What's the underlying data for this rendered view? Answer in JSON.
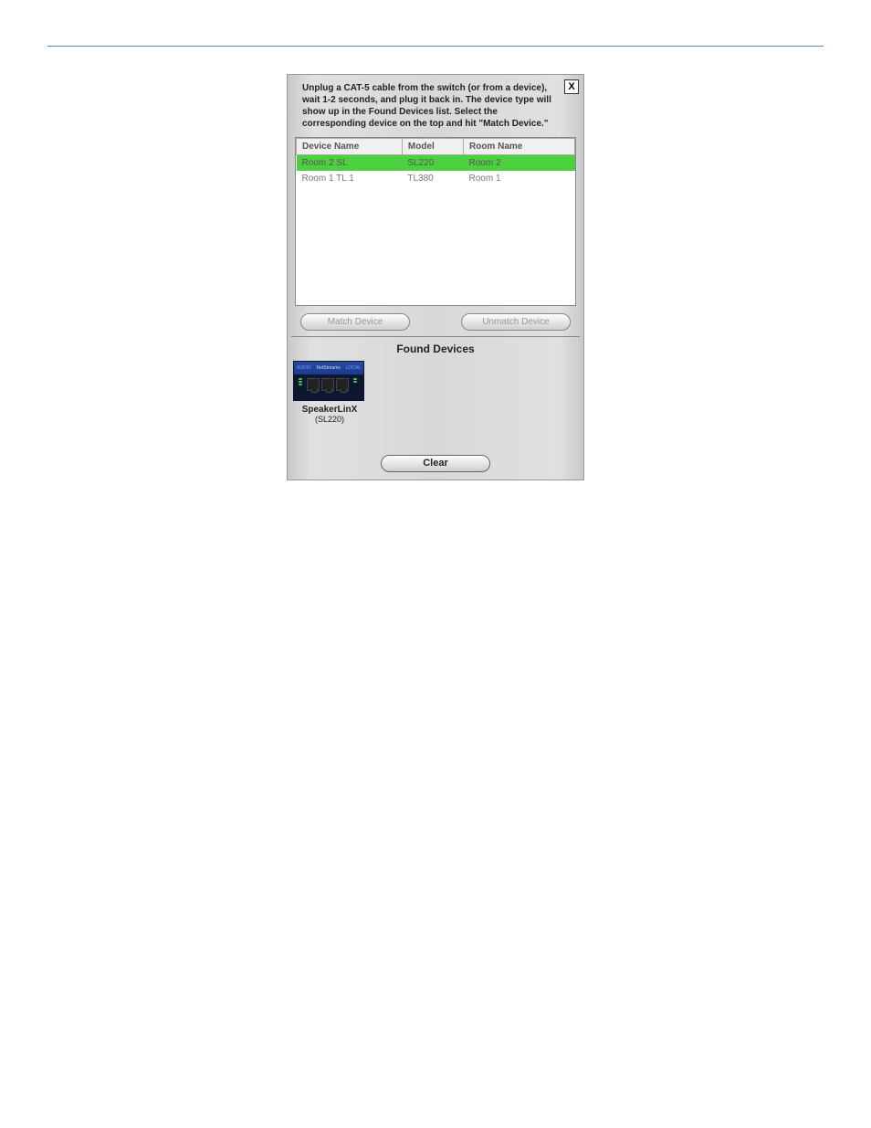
{
  "instruction": "Unplug a CAT-5 cable from the switch (or from a device), wait 1-2 seconds, and plug it back in. The device type will show up in the Found Devices list. Select the corresponding device on the top and hit \"Match Device.\"",
  "close_label": "X",
  "table": {
    "headers": {
      "device_name": "Device Name",
      "model": "Model",
      "room_name": "Room Name"
    },
    "rows": [
      {
        "device_name": "Room 2 SL",
        "model": "SL220",
        "room_name": "Room 2"
      },
      {
        "device_name": "Room 1 TL 1",
        "model": "TL380",
        "room_name": "Room 1"
      }
    ]
  },
  "buttons": {
    "match": "Match Device",
    "unmatch": "Unmatch Device",
    "clear": "Clear"
  },
  "found": {
    "title": "Found Devices",
    "device": {
      "name": "SpeakerLinX",
      "model": "(SL220)"
    }
  }
}
